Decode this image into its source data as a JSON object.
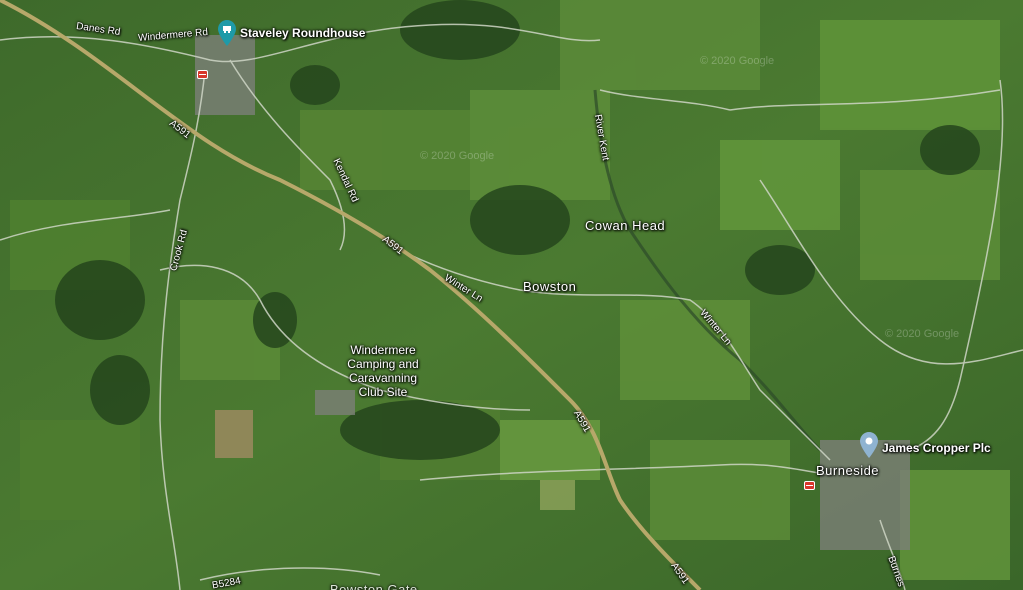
{
  "map": {
    "places": {
      "cowan_head": "Cowan Head",
      "bowston": "Bowston",
      "burneside": "Burneside",
      "bottom_cut": "Bowston Gate"
    },
    "pois": {
      "staveley_roundhouse": "Staveley Roundhouse",
      "james_cropper": "James Cropper Plc",
      "campsite_line1": "Windermere",
      "campsite_line2": "Camping and",
      "campsite_line3": "Caravanning",
      "campsite_line4": "Club Site"
    },
    "roads": {
      "danes_rd": "Danes Rd",
      "windermere_rd": "Windermere Rd",
      "a591_1": "A591",
      "a591_2": "A591",
      "a591_3": "A591",
      "a591_4": "A591",
      "kendal_rd": "Kendal Rd",
      "crook_rd": "Crook Rd",
      "winter_ln_1": "Winter Ln",
      "winter_ln_2": "Winter Ln",
      "river_kent": "River Kent",
      "b5284": "B5284",
      "burneside_rd": "Burnes"
    },
    "watermarks": {
      "wm1": "© 2020 Google",
      "wm2": "© 2020 Google",
      "wm3": "© 2020 Google"
    },
    "colors": {
      "main_road": "#b7a86a",
      "minor_road": "#cfd6c6",
      "pin_teal": "#1e9aa8",
      "pin_blue": "#8fb3d1",
      "rail_red": "#d8372b"
    },
    "icons": {
      "roundhouse_pin": "teal-place-pin",
      "cropper_pin": "blue-place-pin",
      "station": "railway-station-icon"
    }
  }
}
